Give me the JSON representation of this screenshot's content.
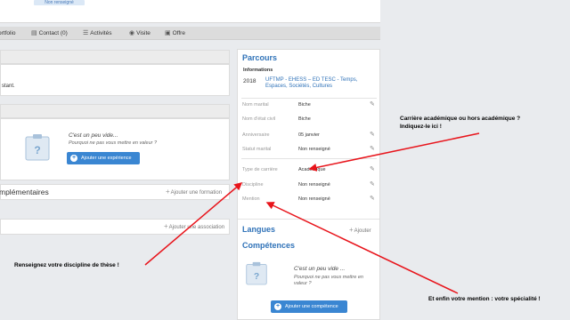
{
  "top": {
    "chip_label": "Non renseigné"
  },
  "nav": [
    {
      "label": "ortfolio",
      "icon": "portfolio-icon"
    },
    {
      "label": "Contact (0)",
      "icon": "contact-card-icon"
    },
    {
      "label": "Activités",
      "icon": "list-icon"
    },
    {
      "label": "Visite",
      "icon": "eye-icon"
    },
    {
      "label": "Offre",
      "icon": "briefcase-icon"
    }
  ],
  "left": {
    "panel1_text": "stant.",
    "experience": {
      "empty_title": "C'est un peu vide...",
      "empty_sub": "Pourquoi ne pas vous mettre en valeur ?",
      "button": "Ajouter une expérience"
    },
    "formations": {
      "title": "mplémentaires",
      "add": "Ajouter une formation"
    },
    "associations": {
      "add": "Ajouter une association"
    }
  },
  "right": {
    "parcours_title": "Parcours",
    "informations_label": "Informations",
    "year": "2018",
    "degree": "UFTMP - EHESS – ED TESC - Temps, Espaces, Sociétés, Cultures",
    "fields": [
      {
        "label": "Nom marital",
        "value": "Biche"
      },
      {
        "label": "Nom d'état civil",
        "value": "Biche"
      },
      {
        "label": "Anniversaire",
        "value": "05 janvier"
      },
      {
        "label": "Statut marital",
        "value": "Non renseigné"
      },
      {
        "label": "Type de carrière",
        "value": "Académique"
      },
      {
        "label": "Discipline",
        "value": "Non renseigné"
      },
      {
        "label": "Mention",
        "value": "Non renseigné"
      }
    ],
    "langues_title": "Langues",
    "langues_add": "Ajouter",
    "competences_title": "Compétences",
    "empty_title": "C'est un peu vide ...",
    "empty_sub": "Pourquoi ne pas vous mettre en valeur ?",
    "button": "Ajouter une compétence"
  },
  "annotations": {
    "career_line1": "Carrière académique ou hors académique ?",
    "career_line2": "Indiquez-le ici !",
    "discipline": "Renseignez votre discipline de thèse !",
    "mention": "Et enfin votre mention : votre spécialité !",
    "arrow_color": "#e8141b"
  },
  "colors": {
    "accent": "#2f72b8",
    "button": "#3a86d2"
  }
}
